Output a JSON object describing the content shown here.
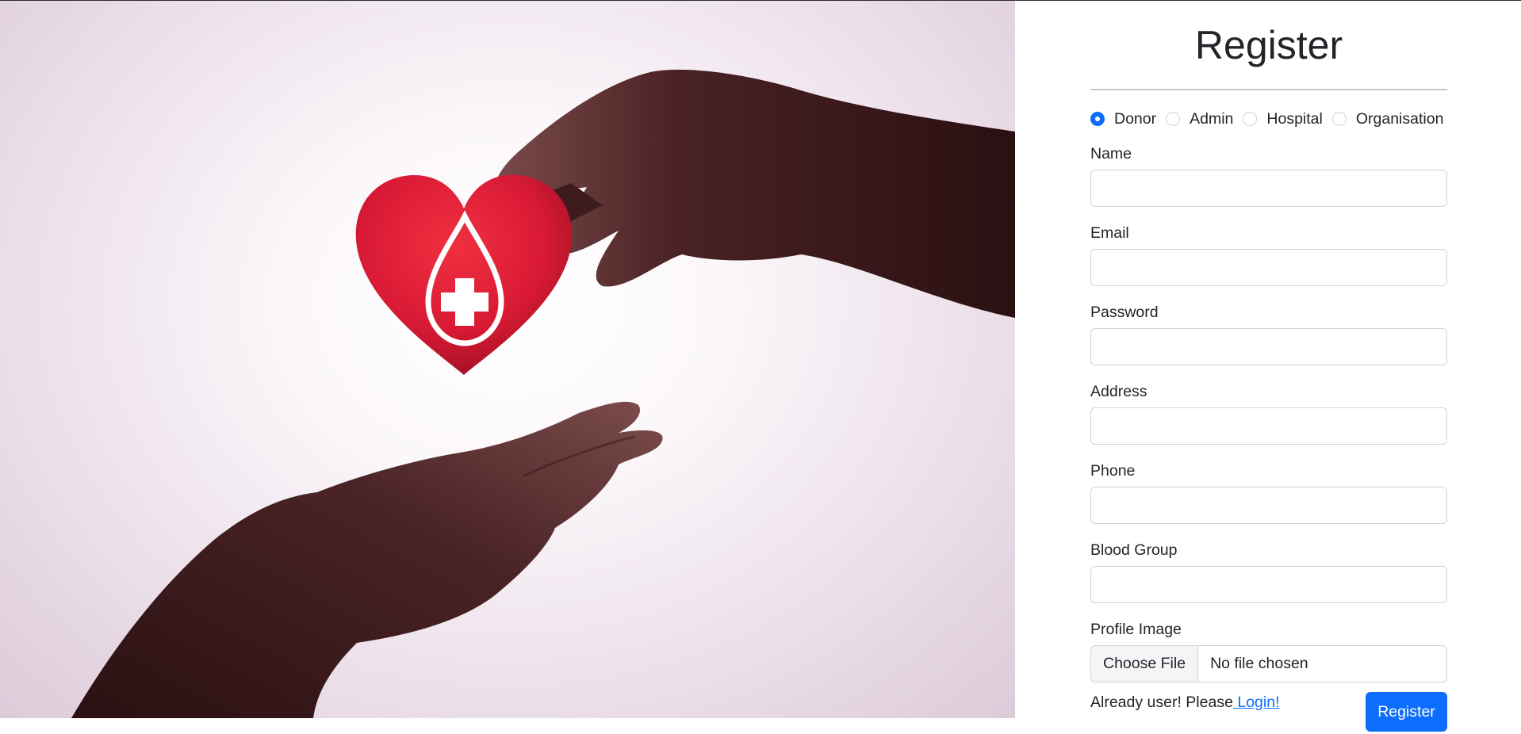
{
  "form": {
    "title": "Register",
    "roles": [
      {
        "label": "Donor",
        "checked": true
      },
      {
        "label": "Admin",
        "checked": false
      },
      {
        "label": "Hospital",
        "checked": false
      },
      {
        "label": "Organisation",
        "checked": false
      }
    ],
    "fields": {
      "name": {
        "label": "Name",
        "value": ""
      },
      "email": {
        "label": "Email",
        "value": ""
      },
      "password": {
        "label": "Password",
        "value": ""
      },
      "address": {
        "label": "Address",
        "value": ""
      },
      "phone": {
        "label": "Phone",
        "value": ""
      },
      "blood_group": {
        "label": "Blood Group",
        "value": ""
      }
    },
    "profile_image": {
      "label": "Profile Image",
      "button": "Choose File",
      "status": "No file chosen"
    },
    "footer": {
      "prompt": "Already user! Please",
      "login_link": " Login!",
      "submit": "Register"
    }
  },
  "colors": {
    "primary": "#0d6efd",
    "heart": "#d91a35",
    "text": "#212529",
    "skin": "#3b1c1e"
  },
  "icons": {
    "hero": "heart-blood-drop-icon"
  }
}
